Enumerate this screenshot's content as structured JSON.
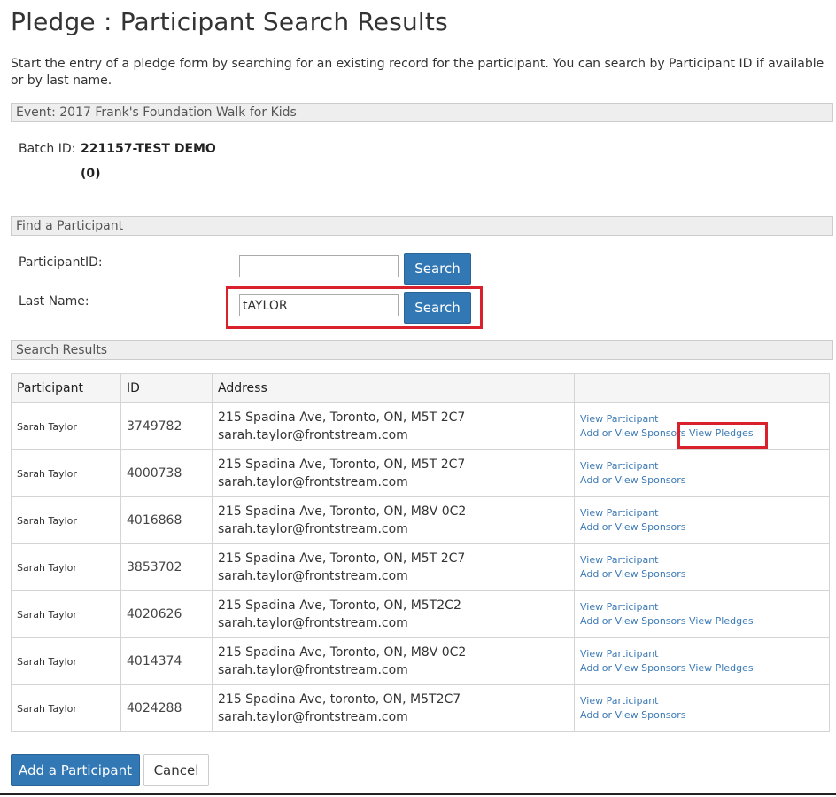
{
  "page": {
    "title": "Pledge : Participant Search Results",
    "intro": "Start the entry of a pledge form by searching for an existing record for the participant. You can search by Participant ID if available or by last name."
  },
  "event": {
    "label": "Event: 2017 Frank's Foundation Walk for Kids"
  },
  "batch": {
    "label": "Batch ID:",
    "value": "221157-TEST DEMO",
    "count": "(0)"
  },
  "find": {
    "section_title": "Find a Participant",
    "participant_id_label": "ParticipantID:",
    "participant_id_value": "",
    "last_name_label": "Last Name:",
    "last_name_value": "tAYLOR",
    "search_label": "Search"
  },
  "results": {
    "section_title": "Search Results",
    "columns": [
      "Participant",
      "ID",
      "Address",
      ""
    ],
    "rows": [
      {
        "name": "Sarah Taylor",
        "id": "3749782",
        "address": "215 Spadina Ave, Toronto, ON, M5T 2C7",
        "email": "sarah.taylor@frontstream.com",
        "view_participant": "View Participant",
        "sponsors": "Add or View Sponsors",
        "pledges": "View Pledges"
      },
      {
        "name": "Sarah Taylor",
        "id": "4000738",
        "address": "215 Spadina Ave, Toronto, ON, M5T 2C7",
        "email": "sarah.taylor@frontstream.com",
        "view_participant": "View Participant",
        "sponsors": "Add or View Sponsors",
        "pledges": ""
      },
      {
        "name": "Sarah Taylor",
        "id": "4016868",
        "address": "215 Spadina Ave, Toronto, ON, M8V 0C2",
        "email": "sarah.taylor@frontstream.com",
        "view_participant": "View Participant",
        "sponsors": "Add or View Sponsors",
        "pledges": ""
      },
      {
        "name": "Sarah Taylor",
        "id": "3853702",
        "address": "215 Spadina Ave, Toronto, ON, M5T 2C7",
        "email": "sarah.taylor@frontstream.com",
        "view_participant": "View Participant",
        "sponsors": "Add or View Sponsors",
        "pledges": ""
      },
      {
        "name": "Sarah Taylor",
        "id": "4020626",
        "address": "215 Spadina Ave, Toronto, ON, M5T2C2",
        "email": "sarah.taylor@frontstream.com",
        "view_participant": "View Participant",
        "sponsors": "Add or View Sponsors",
        "pledges": "View Pledges"
      },
      {
        "name": "Sarah Taylor",
        "id": "4014374",
        "address": "215 Spadina Ave, Toronto, ON, M8V 0C2",
        "email": "sarah.taylor@frontstream.com",
        "view_participant": "View Participant",
        "sponsors": "Add or View Sponsors",
        "pledges": "View Pledges"
      },
      {
        "name": "Sarah Taylor",
        "id": "4024288",
        "address": "215 Spadina Ave, toronto, ON, M5T2C7",
        "email": "sarah.taylor@frontstream.com",
        "view_participant": "View Participant",
        "sponsors": "Add or View Sponsors",
        "pledges": ""
      }
    ]
  },
  "actions": {
    "add_label": "Add a Participant",
    "cancel_label": "Cancel"
  },
  "colors": {
    "accent": "#3278b5",
    "link": "#3c7ab5",
    "highlight": "#d9202d"
  }
}
